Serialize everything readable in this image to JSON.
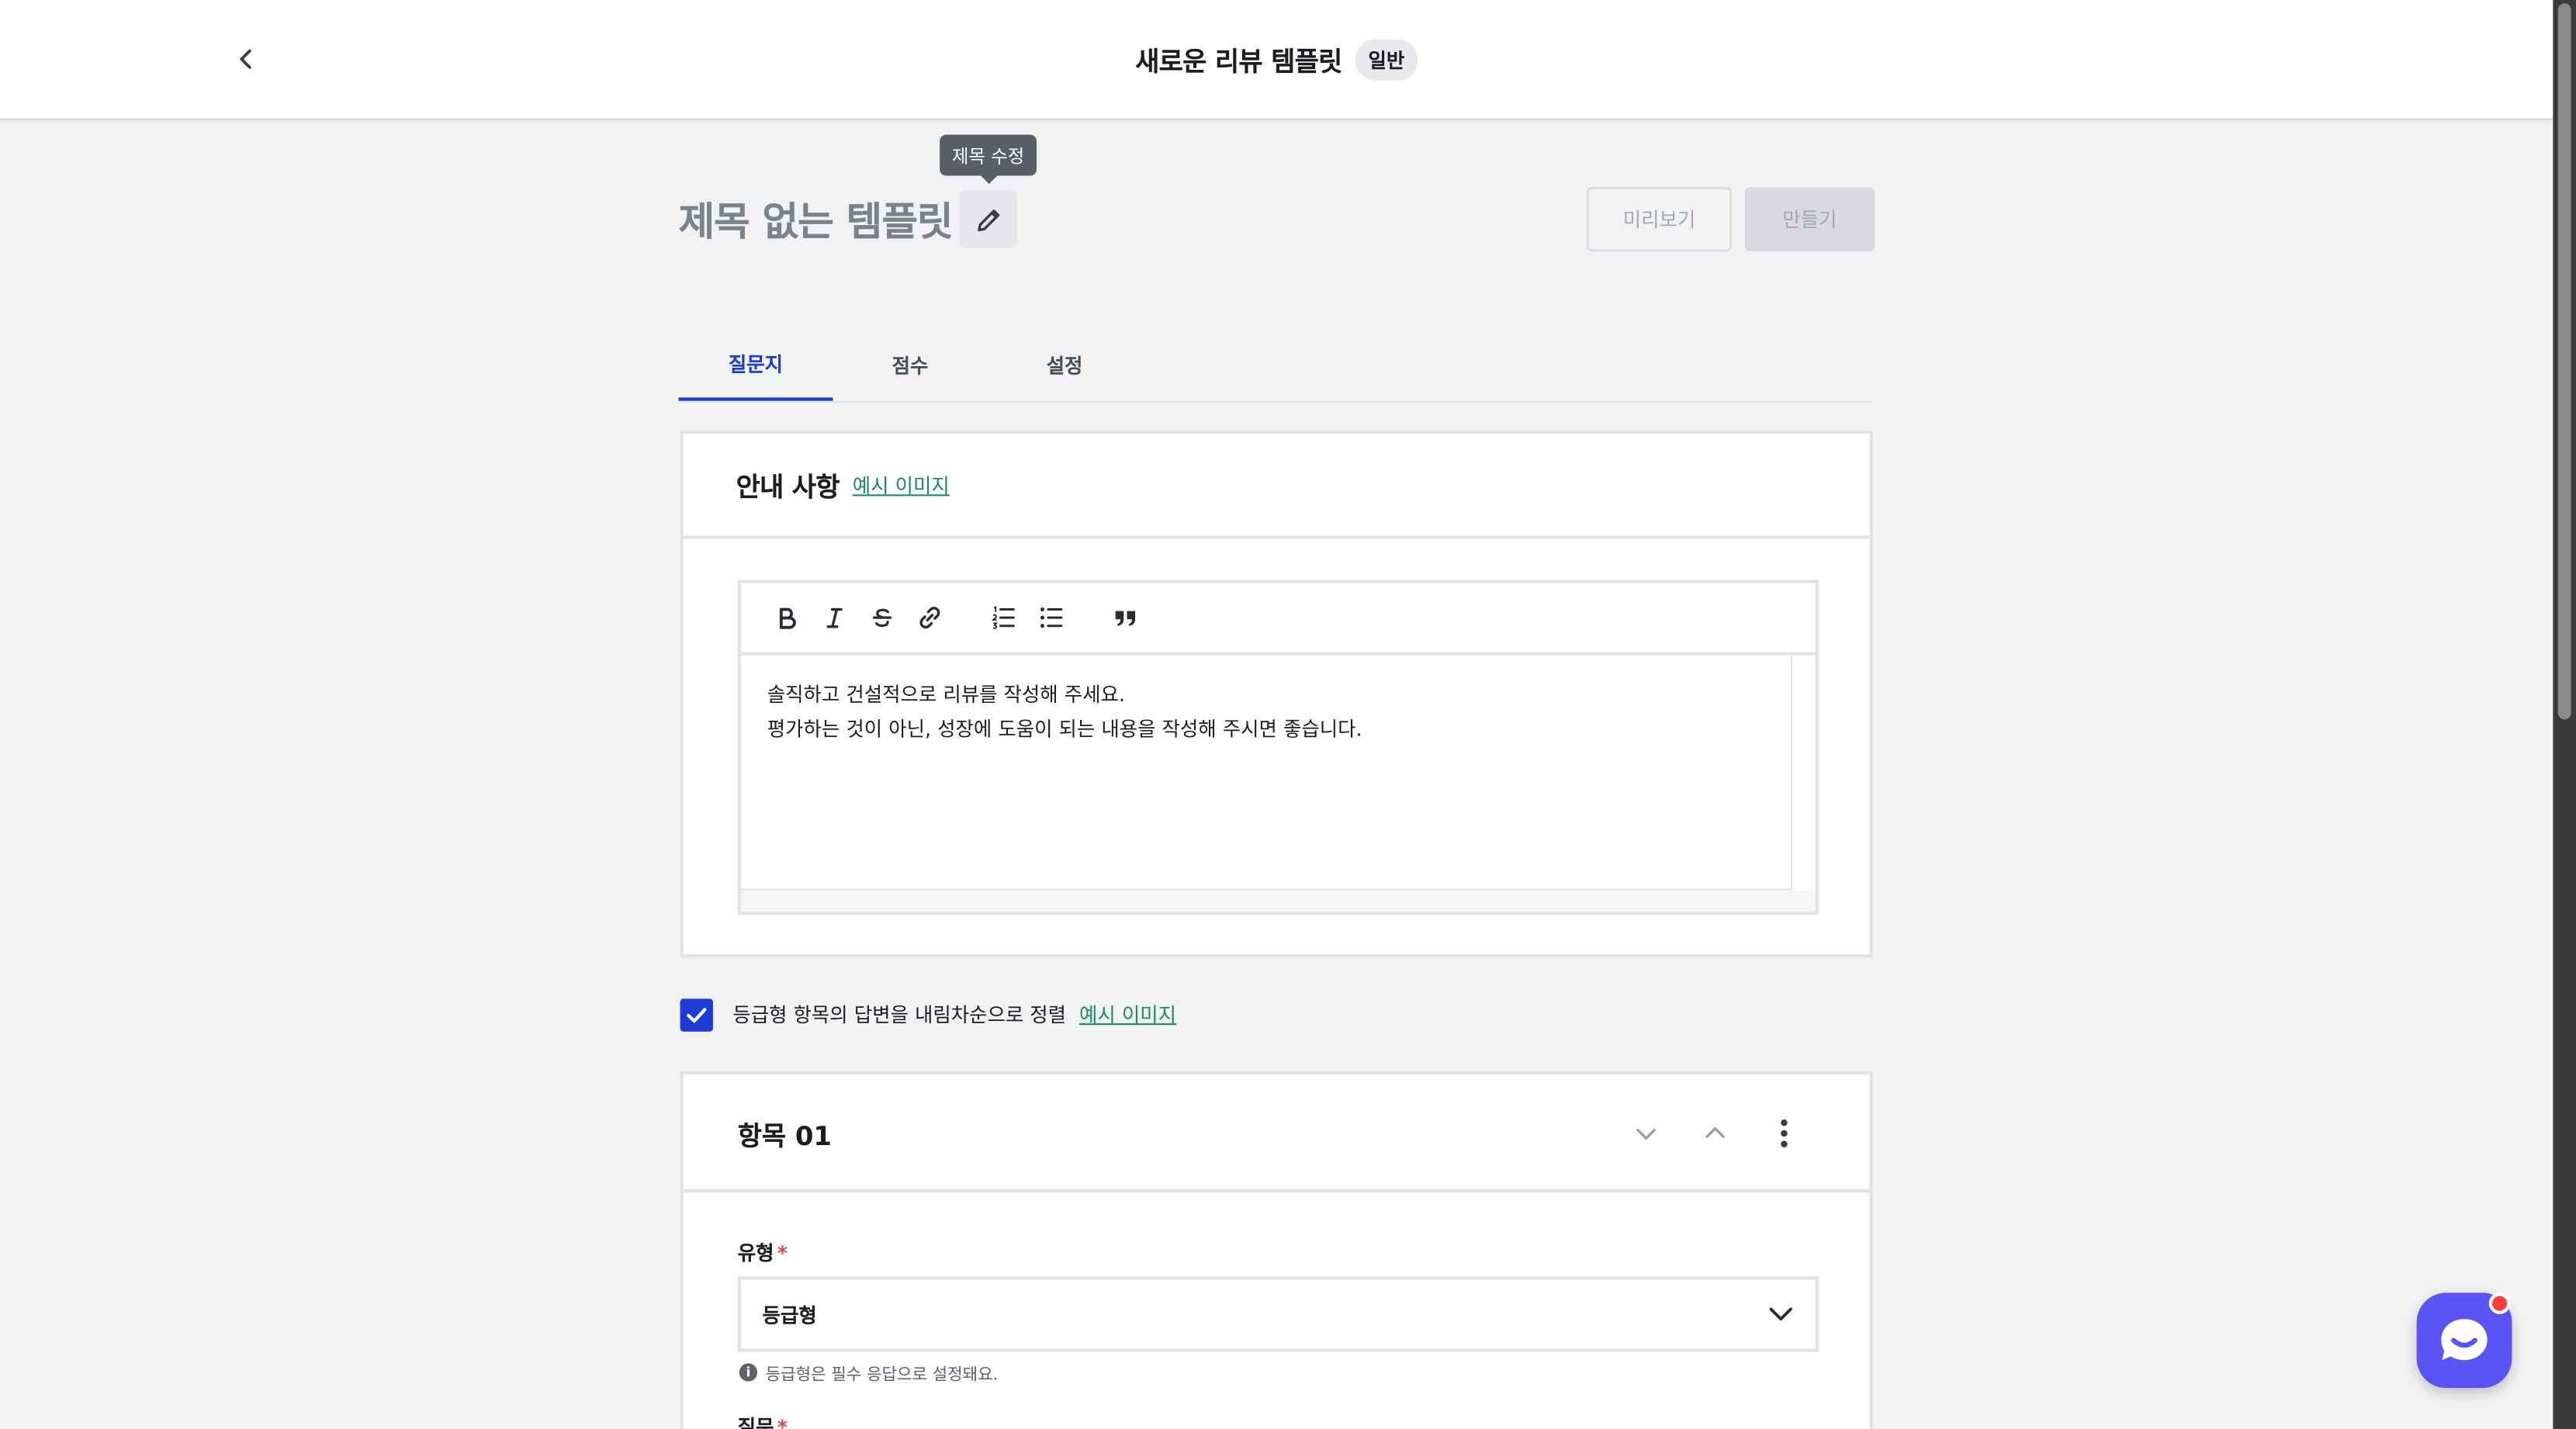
{
  "header": {
    "title": "새로운 리뷰 템플릿",
    "badge": "일반"
  },
  "title_row": {
    "title": "제목 없는 템플릿",
    "tooltip": "제목 수정",
    "preview_label": "미리보기",
    "create_label": "만들기"
  },
  "tabs": [
    {
      "label": "질문지",
      "active": true
    },
    {
      "label": "점수",
      "active": false
    },
    {
      "label": "설정",
      "active": false
    }
  ],
  "notice": {
    "title": "안내 사항",
    "example_link": "예시 이미지",
    "toolbar": [
      "bold-icon",
      "italic-icon",
      "strikethrough-icon",
      "link-icon",
      "ordered-list-icon",
      "bullet-list-icon",
      "quote-icon"
    ],
    "body_lines": [
      "솔직하고 건설적으로 리뷰를 작성해 주세요.",
      "평가하는 것이 아닌, 성장에 도움이 되는 내용을 작성해 주시면 좋습니다."
    ]
  },
  "sort_option": {
    "checked": true,
    "label": "등급형 항목의 답변을 내림차순으로 정렬",
    "example_link": "예시 이미지"
  },
  "item": {
    "title": "항목 01",
    "type_label": "유형",
    "type_value": "등급형",
    "hint": "등급형은 필수 응답으로 설정돼요.",
    "question_label": "질문"
  },
  "colors": {
    "accent": "#1f3bd6",
    "link": "#1a8a5f",
    "required": "#e5484d",
    "chat": "#5a54f5"
  }
}
